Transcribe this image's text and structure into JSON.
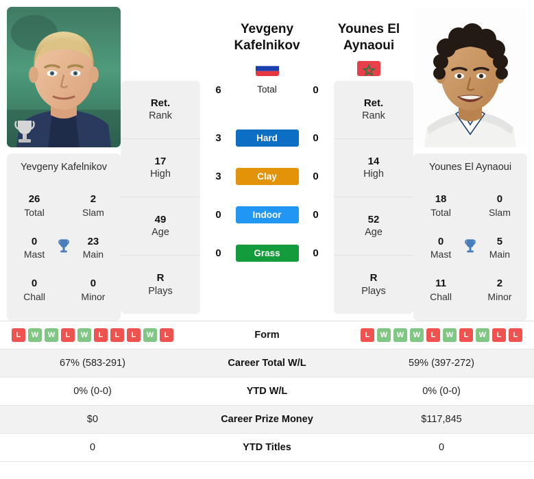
{
  "players": {
    "left": {
      "name_line1": "Yevgeny",
      "name_line2": "Kafelnikov",
      "full_name": "Yevgeny Kafelnikov",
      "flag": "russia-flag",
      "photo_alt": "yevgeny-kafelnikov-photo",
      "titles": {
        "total_val": "26",
        "total_lbl": "Total",
        "slam_val": "2",
        "slam_lbl": "Slam",
        "mast_val": "0",
        "mast_lbl": "Mast",
        "main_val": "23",
        "main_lbl": "Main",
        "chall_val": "0",
        "chall_lbl": "Chall",
        "minor_val": "0",
        "minor_lbl": "Minor"
      },
      "info": {
        "rank_val": "Ret.",
        "rank_lbl": "Rank",
        "high_val": "17",
        "high_lbl": "High",
        "age_val": "49",
        "age_lbl": "Age",
        "plays_val": "R",
        "plays_lbl": "Plays"
      },
      "h2h": {
        "total": "6",
        "hard": "3",
        "clay": "3",
        "indoor": "0",
        "grass": "0"
      },
      "form": [
        "L",
        "W",
        "W",
        "L",
        "W",
        "L",
        "L",
        "L",
        "W",
        "L"
      ],
      "career_wl": "67% (583-291)",
      "ytd_wl": "0% (0-0)",
      "prize_money": "$0",
      "ytd_titles": "0"
    },
    "right": {
      "name_line1": "Younes El",
      "name_line2": "Aynaoui",
      "full_name": "Younes El Aynaoui",
      "flag": "morocco-flag",
      "photo_alt": "younes-el-aynaoui-photo",
      "titles": {
        "total_val": "18",
        "total_lbl": "Total",
        "slam_val": "0",
        "slam_lbl": "Slam",
        "mast_val": "0",
        "mast_lbl": "Mast",
        "main_val": "5",
        "main_lbl": "Main",
        "chall_val": "11",
        "chall_lbl": "Chall",
        "minor_val": "2",
        "minor_lbl": "Minor"
      },
      "info": {
        "rank_val": "Ret.",
        "rank_lbl": "Rank",
        "high_val": "14",
        "high_lbl": "High",
        "age_val": "52",
        "age_lbl": "Age",
        "plays_val": "R",
        "plays_lbl": "Plays"
      },
      "h2h": {
        "total": "0",
        "hard": "0",
        "clay": "0",
        "indoor": "0",
        "grass": "0"
      },
      "form": [
        "L",
        "W",
        "W",
        "W",
        "L",
        "W",
        "L",
        "W",
        "L",
        "L"
      ],
      "career_wl": "59% (397-272)",
      "ytd_wl": "0% (0-0)",
      "prize_money": "$117,845",
      "ytd_titles": "0"
    }
  },
  "surfaces": {
    "total_label": "Total",
    "hard_label": "Hard",
    "clay_label": "Clay",
    "indoor_label": "Indoor",
    "grass_label": "Grass"
  },
  "colors": {
    "hard": "#0d6fc4",
    "clay": "#e39308",
    "indoor": "#2196f3",
    "grass": "#149b3c",
    "win_badge": "#81c784",
    "loss_badge": "#ef5350",
    "trophy": "#4a7ebb",
    "card_bg": "#f0f0f0",
    "row_shade": "#f2f2f2"
  },
  "table_labels": {
    "form": "Form",
    "career_total_wl": "Career Total W/L",
    "ytd_wl": "YTD W/L",
    "career_prize_money": "Career Prize Money",
    "ytd_titles": "YTD Titles"
  }
}
